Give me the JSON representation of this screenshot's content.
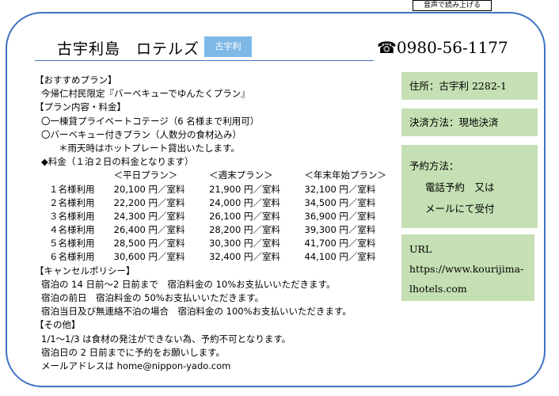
{
  "toolbar": {
    "tts_label": "音声で読み上げる"
  },
  "header": {
    "title": "古宇利島　ロテルズ",
    "tag": "古宇利",
    "phone": "☎0980-56-1177"
  },
  "recommended": {
    "heading": "【おすすめプラン】",
    "line": "今帰仁村民限定『バーベキューでゆんたくプラン』"
  },
  "plan": {
    "heading": "【プラン内容・料金】",
    "items": [
      "〇一棟貸プライベートコテージ（6 名様まで利用可）",
      "〇バーベキュー付きプラン（人数分の食材込み）"
    ],
    "note": "＊雨天時はホットプレート貸出いたします。",
    "price_heading": "◆料金（１泊２日の料金となります）"
  },
  "price_table": {
    "headers": [
      "",
      "＜平日プラン＞",
      "＜週末プラン＞",
      "＜年末年始プラン＞"
    ],
    "rows": [
      [
        "１名様利用",
        "20,100 円／室料",
        "21,900 円／室料",
        "32,100 円／室料"
      ],
      [
        "２名様利用",
        "22,200 円／室料",
        "24,000 円／室料",
        "34,500 円／室料"
      ],
      [
        "３名様利用",
        "24,300 円／室料",
        "26,100 円／室料",
        "36,900 円／室料"
      ],
      [
        "４名様利用",
        "26,400 円／室料",
        "28,200 円／室料",
        "39,300 円／室料"
      ],
      [
        "５名様利用",
        "28,500 円／室料",
        "30,300 円／室料",
        "41,700 円／室料"
      ],
      [
        "６名様利用",
        "30,600 円／室料",
        "32,400 円／室料",
        "44,100 円／室料"
      ]
    ]
  },
  "cancel": {
    "heading": "【キャンセルポリシー】",
    "lines": [
      "宿泊の 14 日前～2 日前まで　宿泊料金の 10%お支払いいただきます。",
      "宿泊の前日　宿泊料金の 50%お支払いいただきます。",
      "宿泊当日及び無連絡不泊の場合　宿泊料金の 100%お支払いいただきます。"
    ]
  },
  "other": {
    "heading": "【その他】",
    "lines": [
      "1/1～1/3 は食材の発注ができない為、予約不可となります。",
      "宿泊日の 2 日前までに予約をお願いします。",
      "メールアドレスは home@nippon-yado.com"
    ]
  },
  "sidebar": {
    "address": "住所：古宇利 2282-1",
    "payment": "決済方法：現地決済",
    "reserve_title": "予約方法：",
    "reserve_line1": "電話予約　又は",
    "reserve_line2": "メールにて受付",
    "url_title": "URL",
    "url_line1": "https://www.kourijima-",
    "url_line2": "lhotels.com"
  },
  "colors": {
    "frame": "#3f72c4",
    "tag_bg": "#7db8e7",
    "side_bg": "#c5e0b4"
  }
}
